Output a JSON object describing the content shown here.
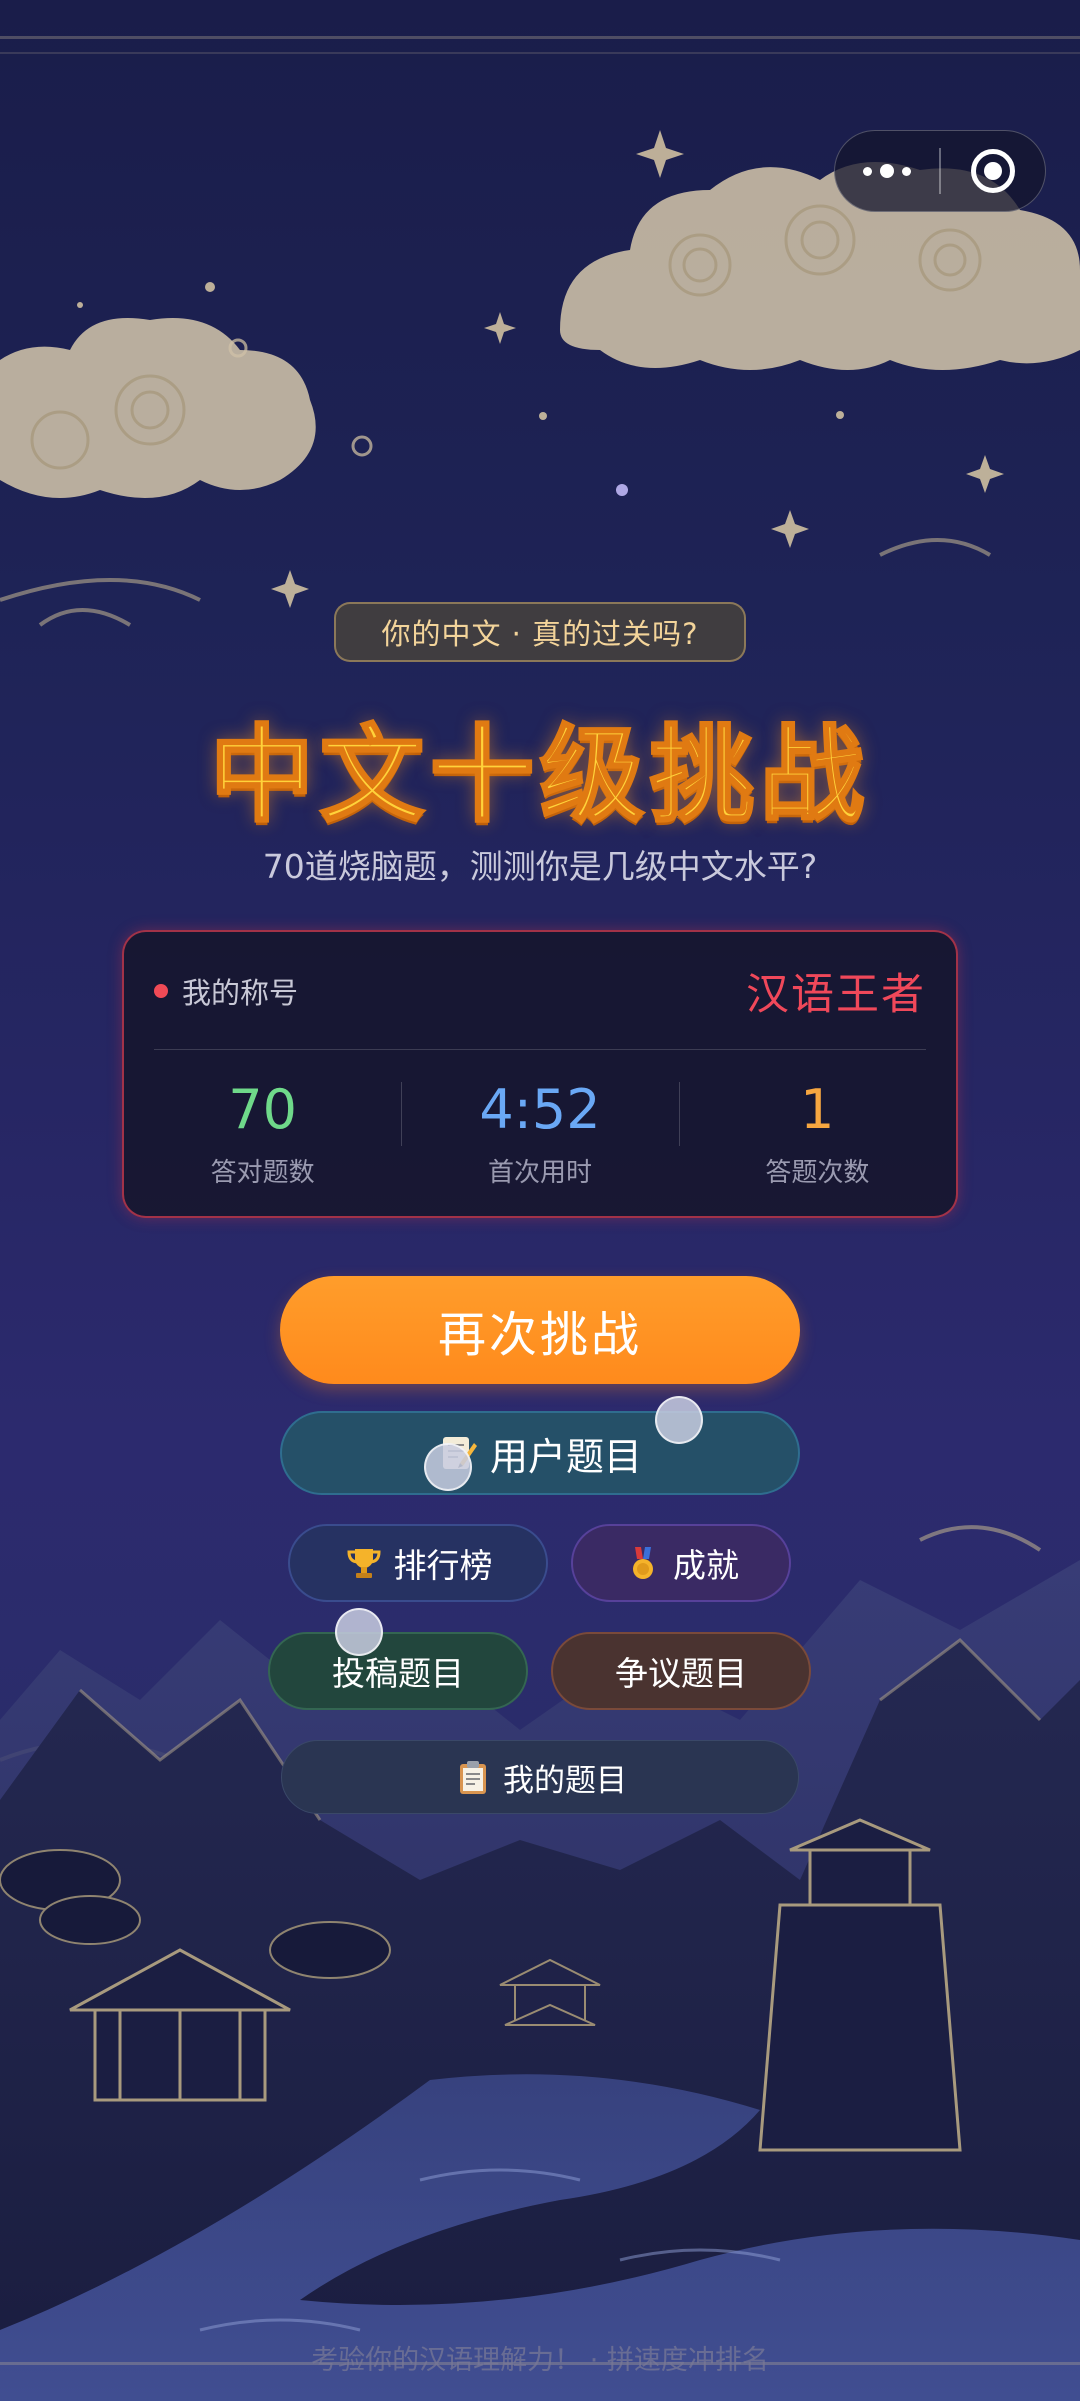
{
  "tagline": "你的中文 · 真的过关吗?",
  "title": "中文十级挑战",
  "subtitle": "70道烧脑题，测测你是几级中文水平?",
  "card": {
    "label": "我的称号",
    "rank": "汉语王者",
    "stats": [
      {
        "value": "70",
        "caption": "答对题数",
        "color": "#6fd98a"
      },
      {
        "value": "4:52",
        "caption": "首次用时",
        "color": "#6aa8f5"
      },
      {
        "value": "1",
        "caption": "答题次数",
        "color": "#f6a640"
      }
    ]
  },
  "buttons": {
    "retry": "再次挑战",
    "user_questions": "用户题目",
    "leaderboard": "排行榜",
    "achievements": "成就",
    "submit": "投稿题目",
    "disputed": "争议题目",
    "my_questions": "我的题目"
  },
  "icons": {
    "user_questions": "memo-icon",
    "leaderboard": "trophy-icon",
    "achievements": "medal-icon",
    "my_questions": "clipboard-icon"
  },
  "footer": "考验你的汉语理解力！ · 拼速度冲排名",
  "colors": {
    "accent": "#ff8f20",
    "title": "#ffd23a",
    "rank": "#f0485a"
  }
}
